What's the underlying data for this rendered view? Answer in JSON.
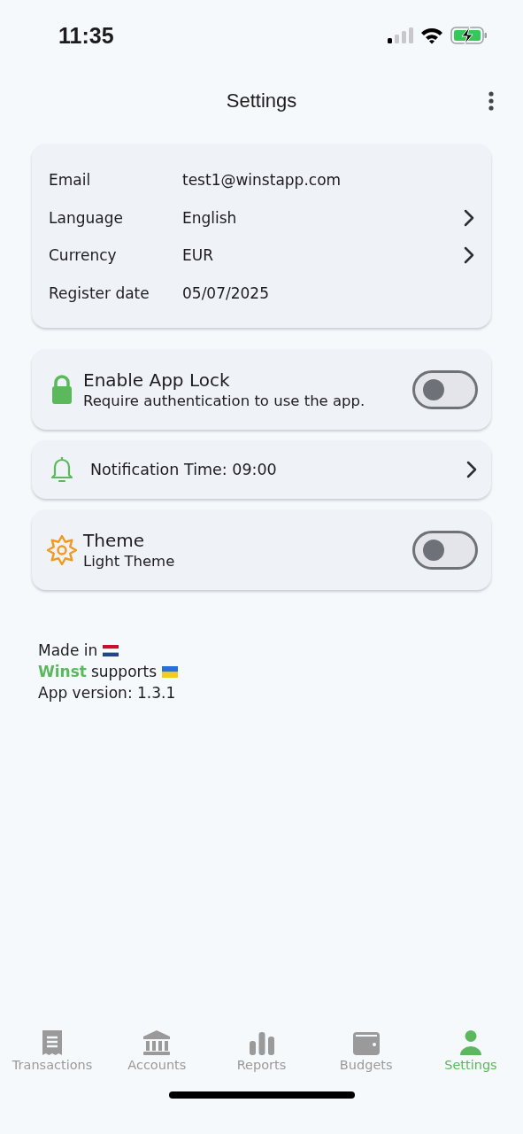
{
  "status_bar": {
    "time": "11:35"
  },
  "header": {
    "title": "Settings"
  },
  "account_info": [
    {
      "label": "Email",
      "value": "test1@winstapp.com",
      "chevron": false
    },
    {
      "label": "Language",
      "value": "English",
      "chevron": true
    },
    {
      "label": "Currency",
      "value": "EUR",
      "chevron": true
    },
    {
      "label": "Register date",
      "value": "05/07/2025",
      "chevron": false
    }
  ],
  "settings": [
    {
      "kind": "toggle",
      "title": "Enable App Lock",
      "subtitle": "Require authentication to use the app.",
      "on": false
    },
    {
      "kind": "link",
      "title": "Notification Time: 09:00"
    },
    {
      "kind": "toggle",
      "title": "Theme",
      "subtitle": "Light Theme",
      "on": false
    }
  ],
  "footer": {
    "made_in": "Made in",
    "brand": "Winst",
    "supports": "supports",
    "version": "App version: 1.3.1"
  },
  "nav": [
    {
      "kind": "receipt",
      "label": "Transactions",
      "selected": false
    },
    {
      "kind": "bank",
      "label": "Accounts",
      "selected": false
    },
    {
      "kind": "chart",
      "label": "Reports",
      "selected": false
    },
    {
      "kind": "wallet",
      "label": "Budgets",
      "selected": false
    },
    {
      "kind": "person",
      "label": "Settings",
      "selected": true
    }
  ]
}
